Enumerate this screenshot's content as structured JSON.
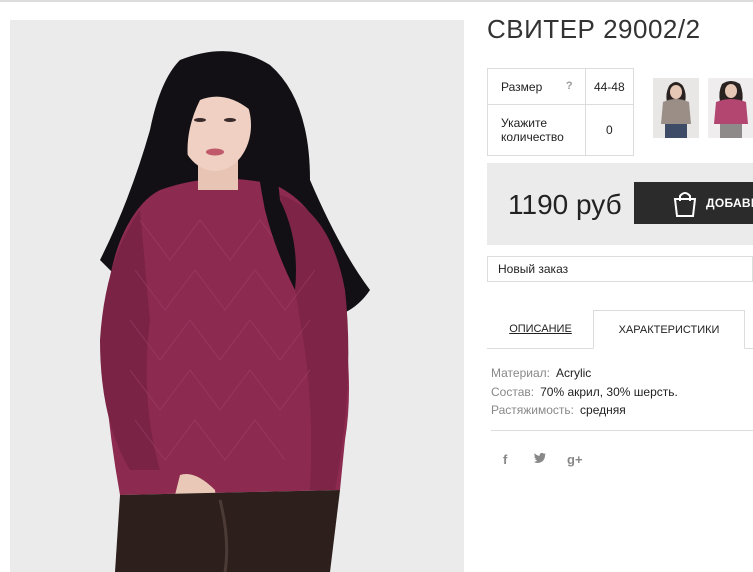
{
  "product": {
    "title": "СВИТЕР 29002/2",
    "image_desc": "woman in burgundy knit sweater"
  },
  "options": {
    "size_label": "Размер",
    "size_help": "?",
    "size_value": "44-48",
    "qty_label_line1": "Укажите",
    "qty_label_line2": "количество",
    "qty_value": "0"
  },
  "purchase": {
    "price": "1190 руб",
    "add_button": "ДОБАВИ",
    "order_select": "Новый заказ"
  },
  "tabs": [
    {
      "label": "ОПИСАНИЕ"
    },
    {
      "label": "ХАРАКТЕРИСТИКИ"
    }
  ],
  "characteristics": [
    {
      "key": "Материал:",
      "value": "Acrylic"
    },
    {
      "key": "Состав:",
      "value": "70% акрил, 30% шерсть."
    },
    {
      "key": "Растяжимость:",
      "value": "средняя"
    }
  ],
  "social": {
    "facebook": "f",
    "twitter": "twitter-icon",
    "googleplus": "g+"
  },
  "colors": {
    "sweater": "#8c2a4f",
    "button": "#2b2b2b",
    "price_bg": "#ebebeb"
  }
}
